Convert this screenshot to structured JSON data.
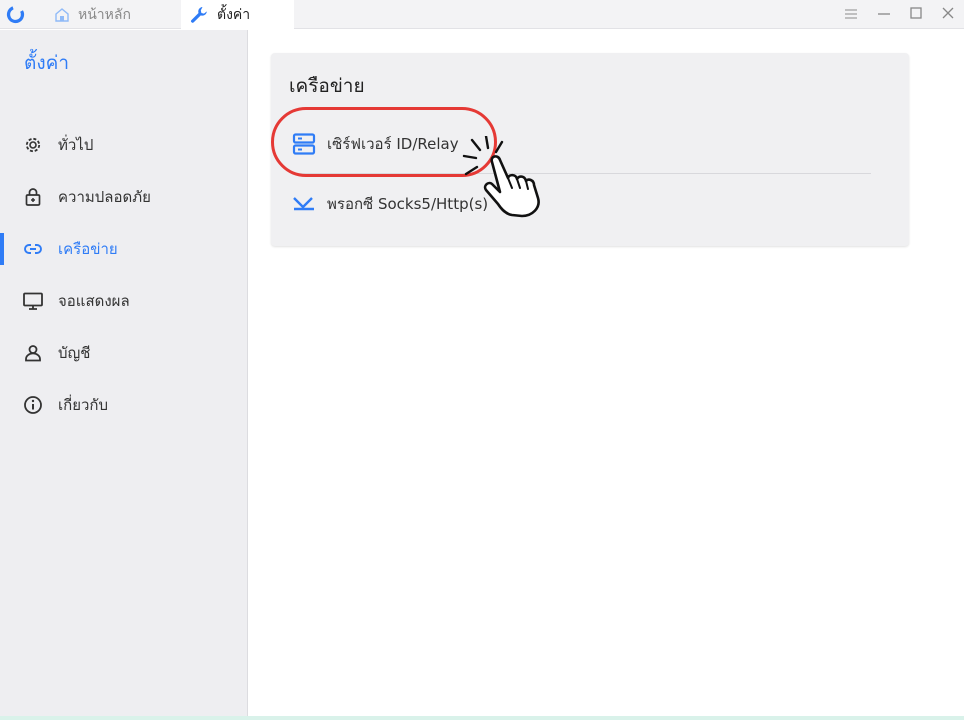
{
  "titlebar": {
    "tabs": [
      {
        "label": "หน้าหลัก",
        "icon": "home-icon",
        "active": false
      },
      {
        "label": "ตั้งค่า",
        "icon": "wrench-icon",
        "active": true
      }
    ],
    "controls": [
      "menu-icon",
      "minimize-icon",
      "maximize-icon",
      "close-icon"
    ]
  },
  "sidebar": {
    "title": "ตั้งค่า",
    "items": [
      {
        "label": "ทั่วไป",
        "icon": "gear-icon"
      },
      {
        "label": "ความปลอดภัย",
        "icon": "lock-icon"
      },
      {
        "label": "เครือข่าย",
        "icon": "link-icon",
        "active": true
      },
      {
        "label": "จอแสดงผล",
        "icon": "monitor-icon"
      },
      {
        "label": "บัญชี",
        "icon": "person-icon"
      },
      {
        "label": "เกี่ยวกับ",
        "icon": "info-icon"
      }
    ]
  },
  "main": {
    "card_title": "เครือข่าย",
    "rows": [
      {
        "label": "เซิร์ฟเวอร์ ID/Relay",
        "icon": "server-icon"
      },
      {
        "label": "พรอกซี Socks5/Http(s)",
        "icon": "proxy-icon"
      }
    ]
  },
  "colors": {
    "accent": "#2f7cf6",
    "highlight": "#e53935",
    "sidebar_bg": "#eeeef1",
    "card_bg": "#f0f0f2"
  }
}
